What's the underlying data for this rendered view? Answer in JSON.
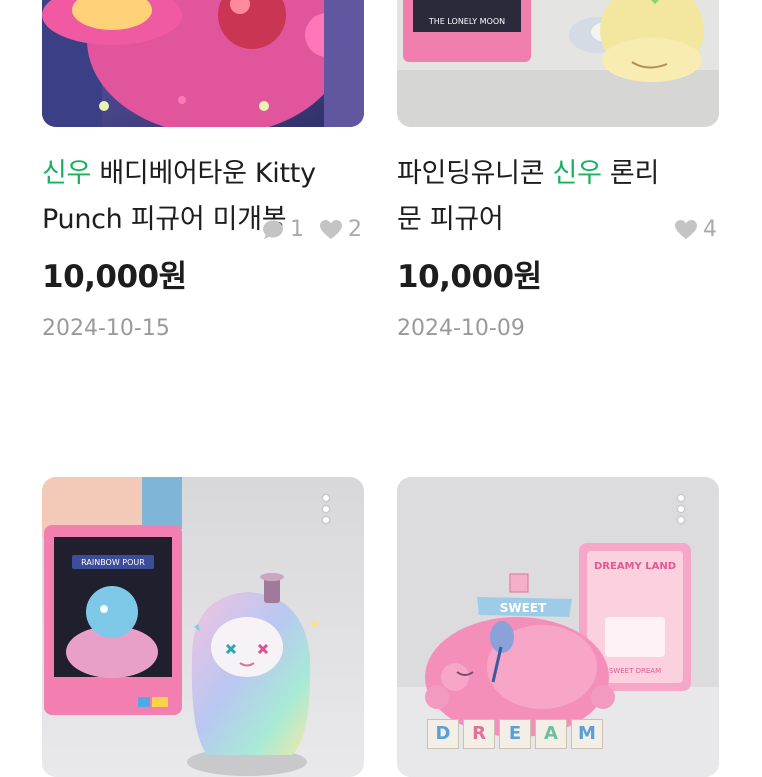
{
  "products": [
    {
      "title_keyword": "신우",
      "title_rest": " 배디베어타운 Kitty",
      "title_line2": "Punch 피규어 미개봉",
      "price": "10,000원",
      "date": "2024-10-15",
      "chat_count": "1",
      "like_count": "2"
    },
    {
      "title_line1_pre": "파인딩유니콘 ",
      "title_keyword": "신우",
      "title_line1_post": " 론리",
      "title_line2": "문 피규어",
      "price": "10,000원",
      "date": "2024-10-09",
      "like_count": "4"
    },
    {
      "box_text_top": "RAINBOW POUR",
      "box_text_bottom": "THE LONELY MOON"
    },
    {
      "box_title": "DREAMY LAND",
      "box_subtitle": "SWEET DREAM",
      "banner_text": "SWEET",
      "blocks": [
        "D",
        "R",
        "E",
        "A",
        "M"
      ]
    }
  ],
  "colors": {
    "keyword": "#17b25b",
    "text": "#1d1d1d",
    "muted": "#9a9a9a",
    "icon": "#c4c4c4"
  },
  "icons": [
    "chat-bubble-icon",
    "heart-icon",
    "more-vert-icon"
  ]
}
